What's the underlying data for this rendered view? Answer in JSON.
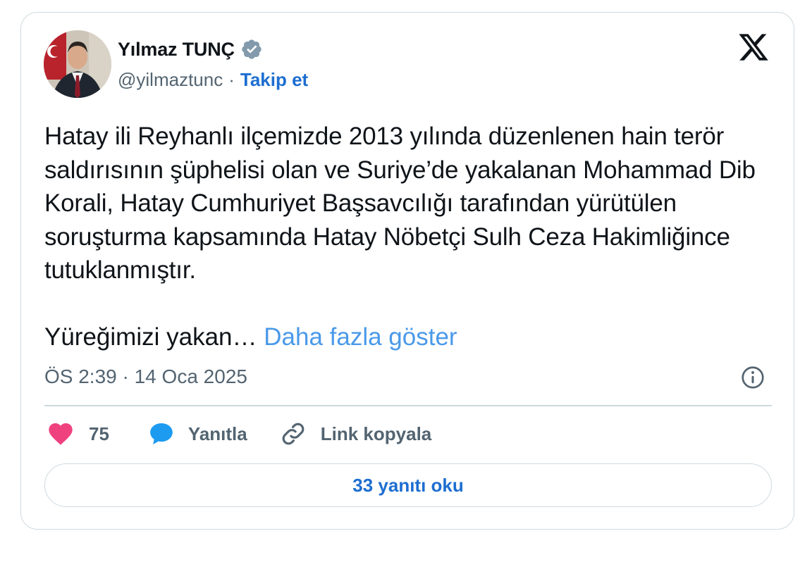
{
  "author": {
    "name": "Yılmaz TUNÇ",
    "handle": "@yilmaztunc",
    "separator": "·",
    "follow_label": "Takip et",
    "verified_icon": "verified-badge-icon"
  },
  "tweet": {
    "text": "Hatay ili Reyhanlı ilçemizde 2013 yılında düzenlenen hain terör saldırısının şüphelisi olan ve Suriye’de yakalanan Mohammad Dib Korali, Hatay Cumhuriyet Başsavcılığı tarafından yürütülen soruşturma kapsamında Hatay Nöbetçi Sulh Ceza Hakimliğince tutuklanmıştır.",
    "truncated_text": "Yüreğimizi yakan…",
    "show_more_label": "Daha fazla göster",
    "timestamp": "ÖS 2:39 · 14 Oca 2025"
  },
  "actions": {
    "likes_count": "75",
    "reply_label": "Yanıtla",
    "copy_link_label": "Link kopyala"
  },
  "footer": {
    "read_replies_label": "33 yanıtı oku"
  },
  "colors": {
    "link_blue": "#1d6ed0",
    "more_blue": "#4a99e9",
    "like_pink": "#f0417f",
    "reply_blue": "#1d9bf0",
    "muted": "#536471",
    "border": "#cfd9de"
  }
}
